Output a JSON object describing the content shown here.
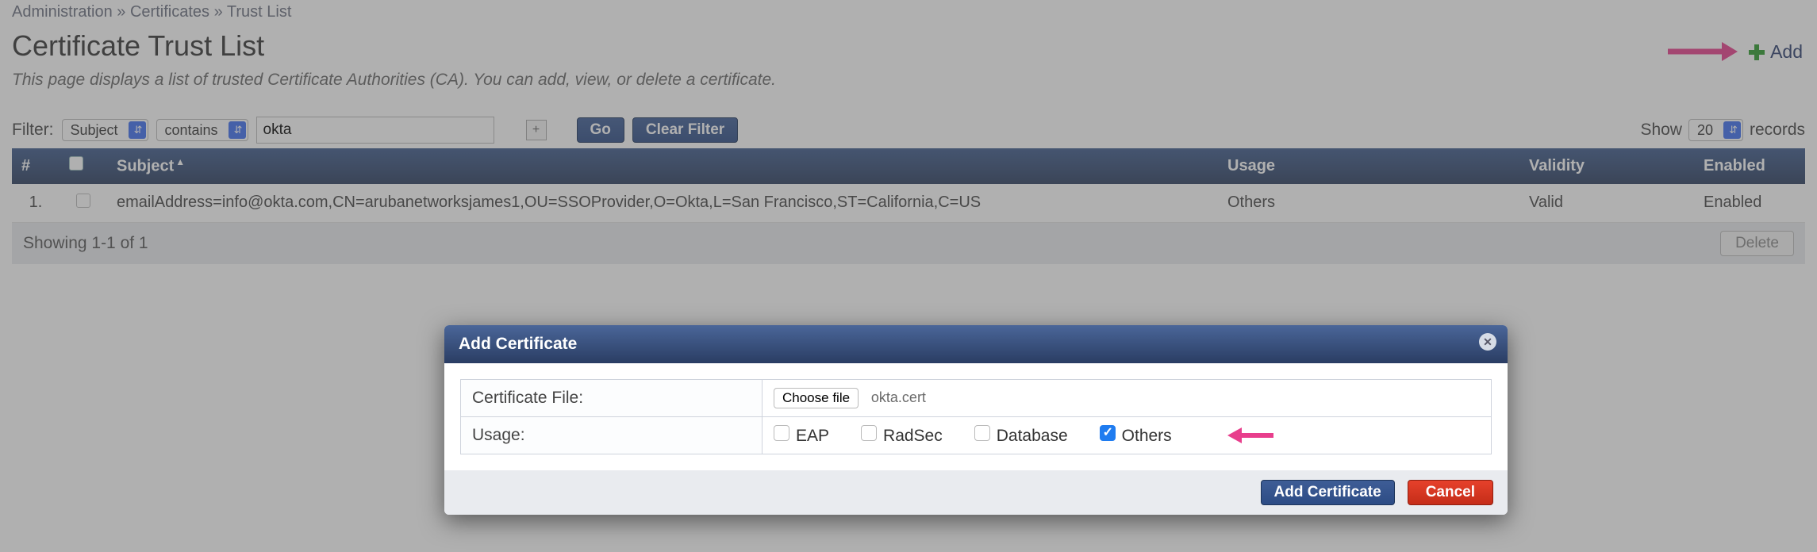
{
  "breadcrumb": {
    "a": "Administration",
    "b": "Certificates",
    "c": "Trust List",
    "sep": "»"
  },
  "page": {
    "title": "Certificate Trust List",
    "desc": "This page displays a list of trusted Certificate Authorities (CA). You can add, view, or delete a certificate."
  },
  "add_link": {
    "label": "Add"
  },
  "filter": {
    "label": "Filter:",
    "field": "Subject",
    "op": "contains",
    "value": "okta",
    "go": "Go",
    "clear": "Clear Filter"
  },
  "show": {
    "label": "Show",
    "count": "20",
    "suffix": "records"
  },
  "table": {
    "headers": {
      "num": "#",
      "subject": "Subject",
      "usage": "Usage",
      "validity": "Validity",
      "enabled": "Enabled"
    },
    "rows": [
      {
        "num": "1.",
        "subject": "emailAddress=info@okta.com,CN=arubanetworksjames1,OU=SSOProvider,O=Okta,L=San Francisco,ST=California,C=US",
        "usage": "Others",
        "validity": "Valid",
        "enabled": "Enabled"
      }
    ],
    "footer": {
      "showing": "Showing 1-1 of 1",
      "delete": "Delete"
    }
  },
  "modal": {
    "title": "Add Certificate",
    "fields": {
      "cert_file_label": "Certificate File:",
      "choose_file": "Choose file",
      "file_name": "okta.cert",
      "usage_label": "Usage:",
      "eap": "EAP",
      "radsec": "RadSec",
      "database": "Database",
      "others": "Others"
    },
    "buttons": {
      "add": "Add Certificate",
      "cancel": "Cancel"
    }
  }
}
